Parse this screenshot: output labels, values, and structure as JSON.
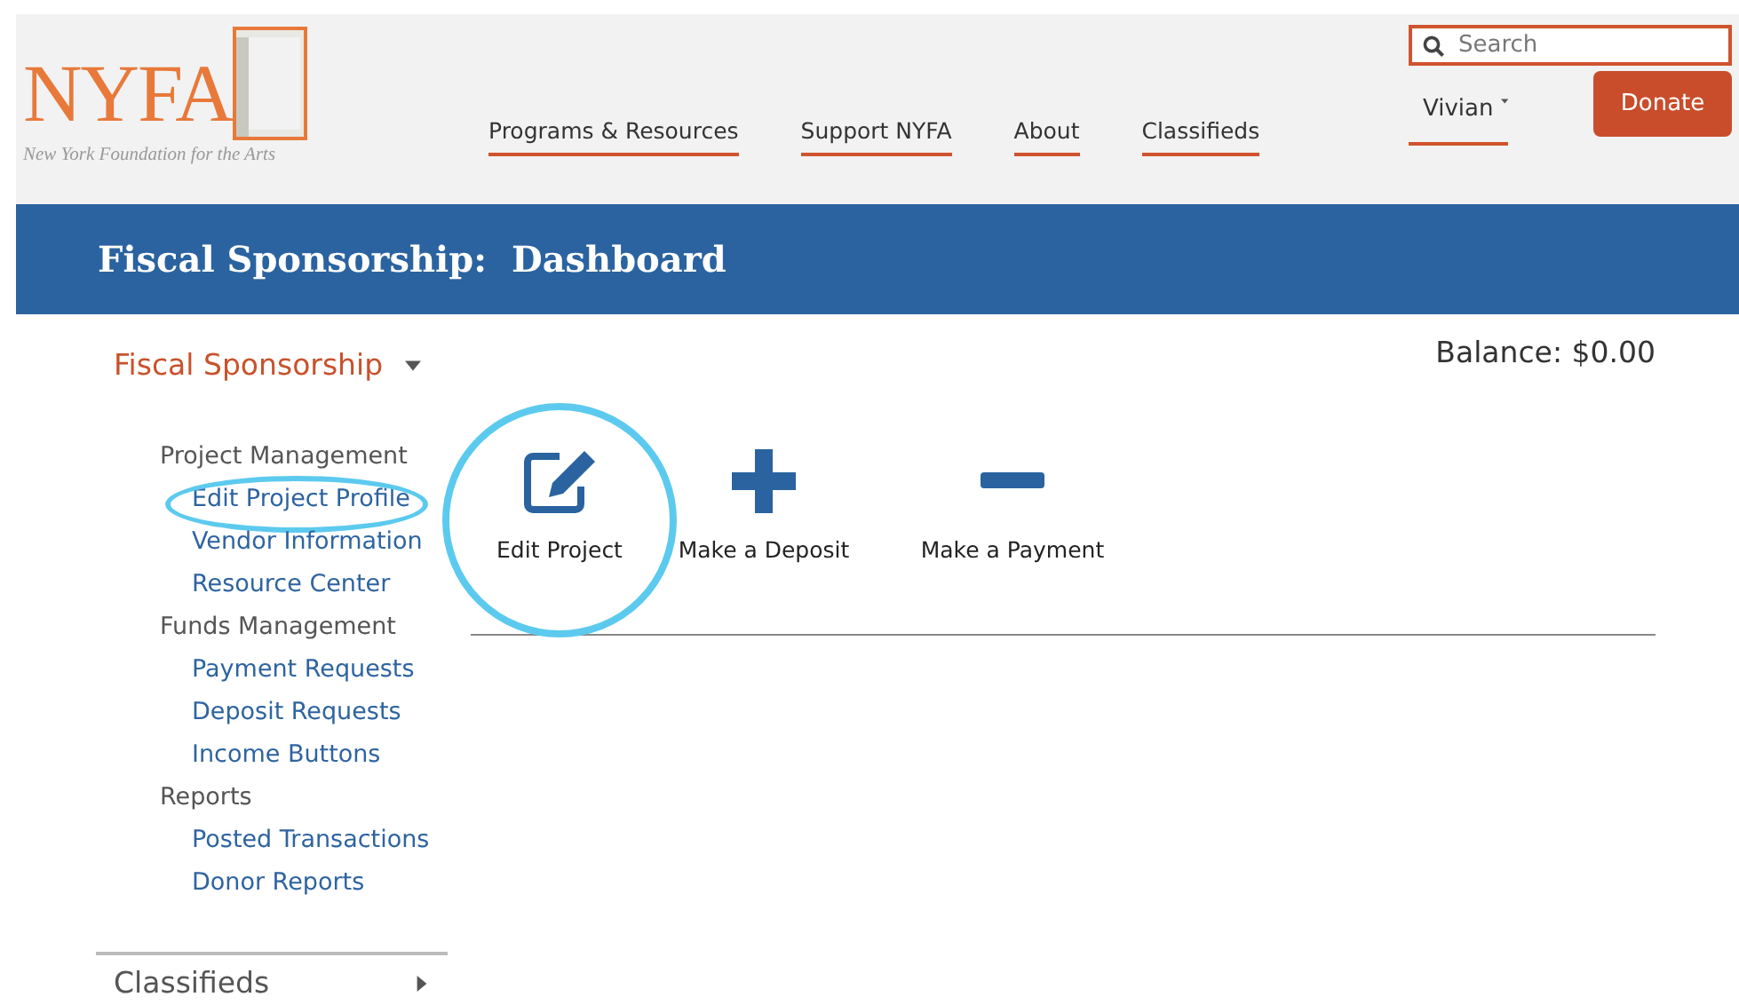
{
  "header": {
    "logo": {
      "wordmark": "NYFA",
      "tagline": "New York Foundation for the Arts"
    },
    "nav": [
      {
        "label": "Programs & Resources"
      },
      {
        "label": "Support NYFA"
      },
      {
        "label": "About"
      },
      {
        "label": "Classifieds"
      }
    ],
    "search": {
      "placeholder": "Search"
    },
    "user": {
      "name": "Vivian"
    },
    "donate": "Donate"
  },
  "banner": {
    "title": "Fiscal Sponsorship:",
    "subtitle": "Dashboard"
  },
  "sidebar": {
    "heading": "Fiscal Sponsorship",
    "expanded": true,
    "groups": [
      {
        "label": "Project Management",
        "children": [
          {
            "label": "Edit Project Profile",
            "highlighted": true
          },
          {
            "label": "Vendor Information",
            "highlighted": false
          },
          {
            "label": "Resource Center",
            "highlighted": false
          }
        ]
      },
      {
        "label": "Funds Management",
        "children": [
          {
            "label": "Payment Requests",
            "highlighted": false
          },
          {
            "label": "Deposit Requests",
            "highlighted": false
          },
          {
            "label": "Income Buttons",
            "highlighted": false
          }
        ]
      },
      {
        "label": "Reports",
        "children": [
          {
            "label": "Posted Transactions",
            "highlighted": false
          },
          {
            "label": "Donor Reports",
            "highlighted": false
          }
        ]
      }
    ],
    "footer": {
      "label": "Classifieds",
      "expanded": false
    }
  },
  "balance": "Balance: $0.00",
  "actions": [
    {
      "kind": "edit",
      "label": "Edit Project",
      "highlighted": true
    },
    {
      "kind": "plus",
      "label": "Make a Deposit",
      "highlighted": false
    },
    {
      "kind": "minus",
      "label": "Make a Payment",
      "highlighted": false
    }
  ]
}
